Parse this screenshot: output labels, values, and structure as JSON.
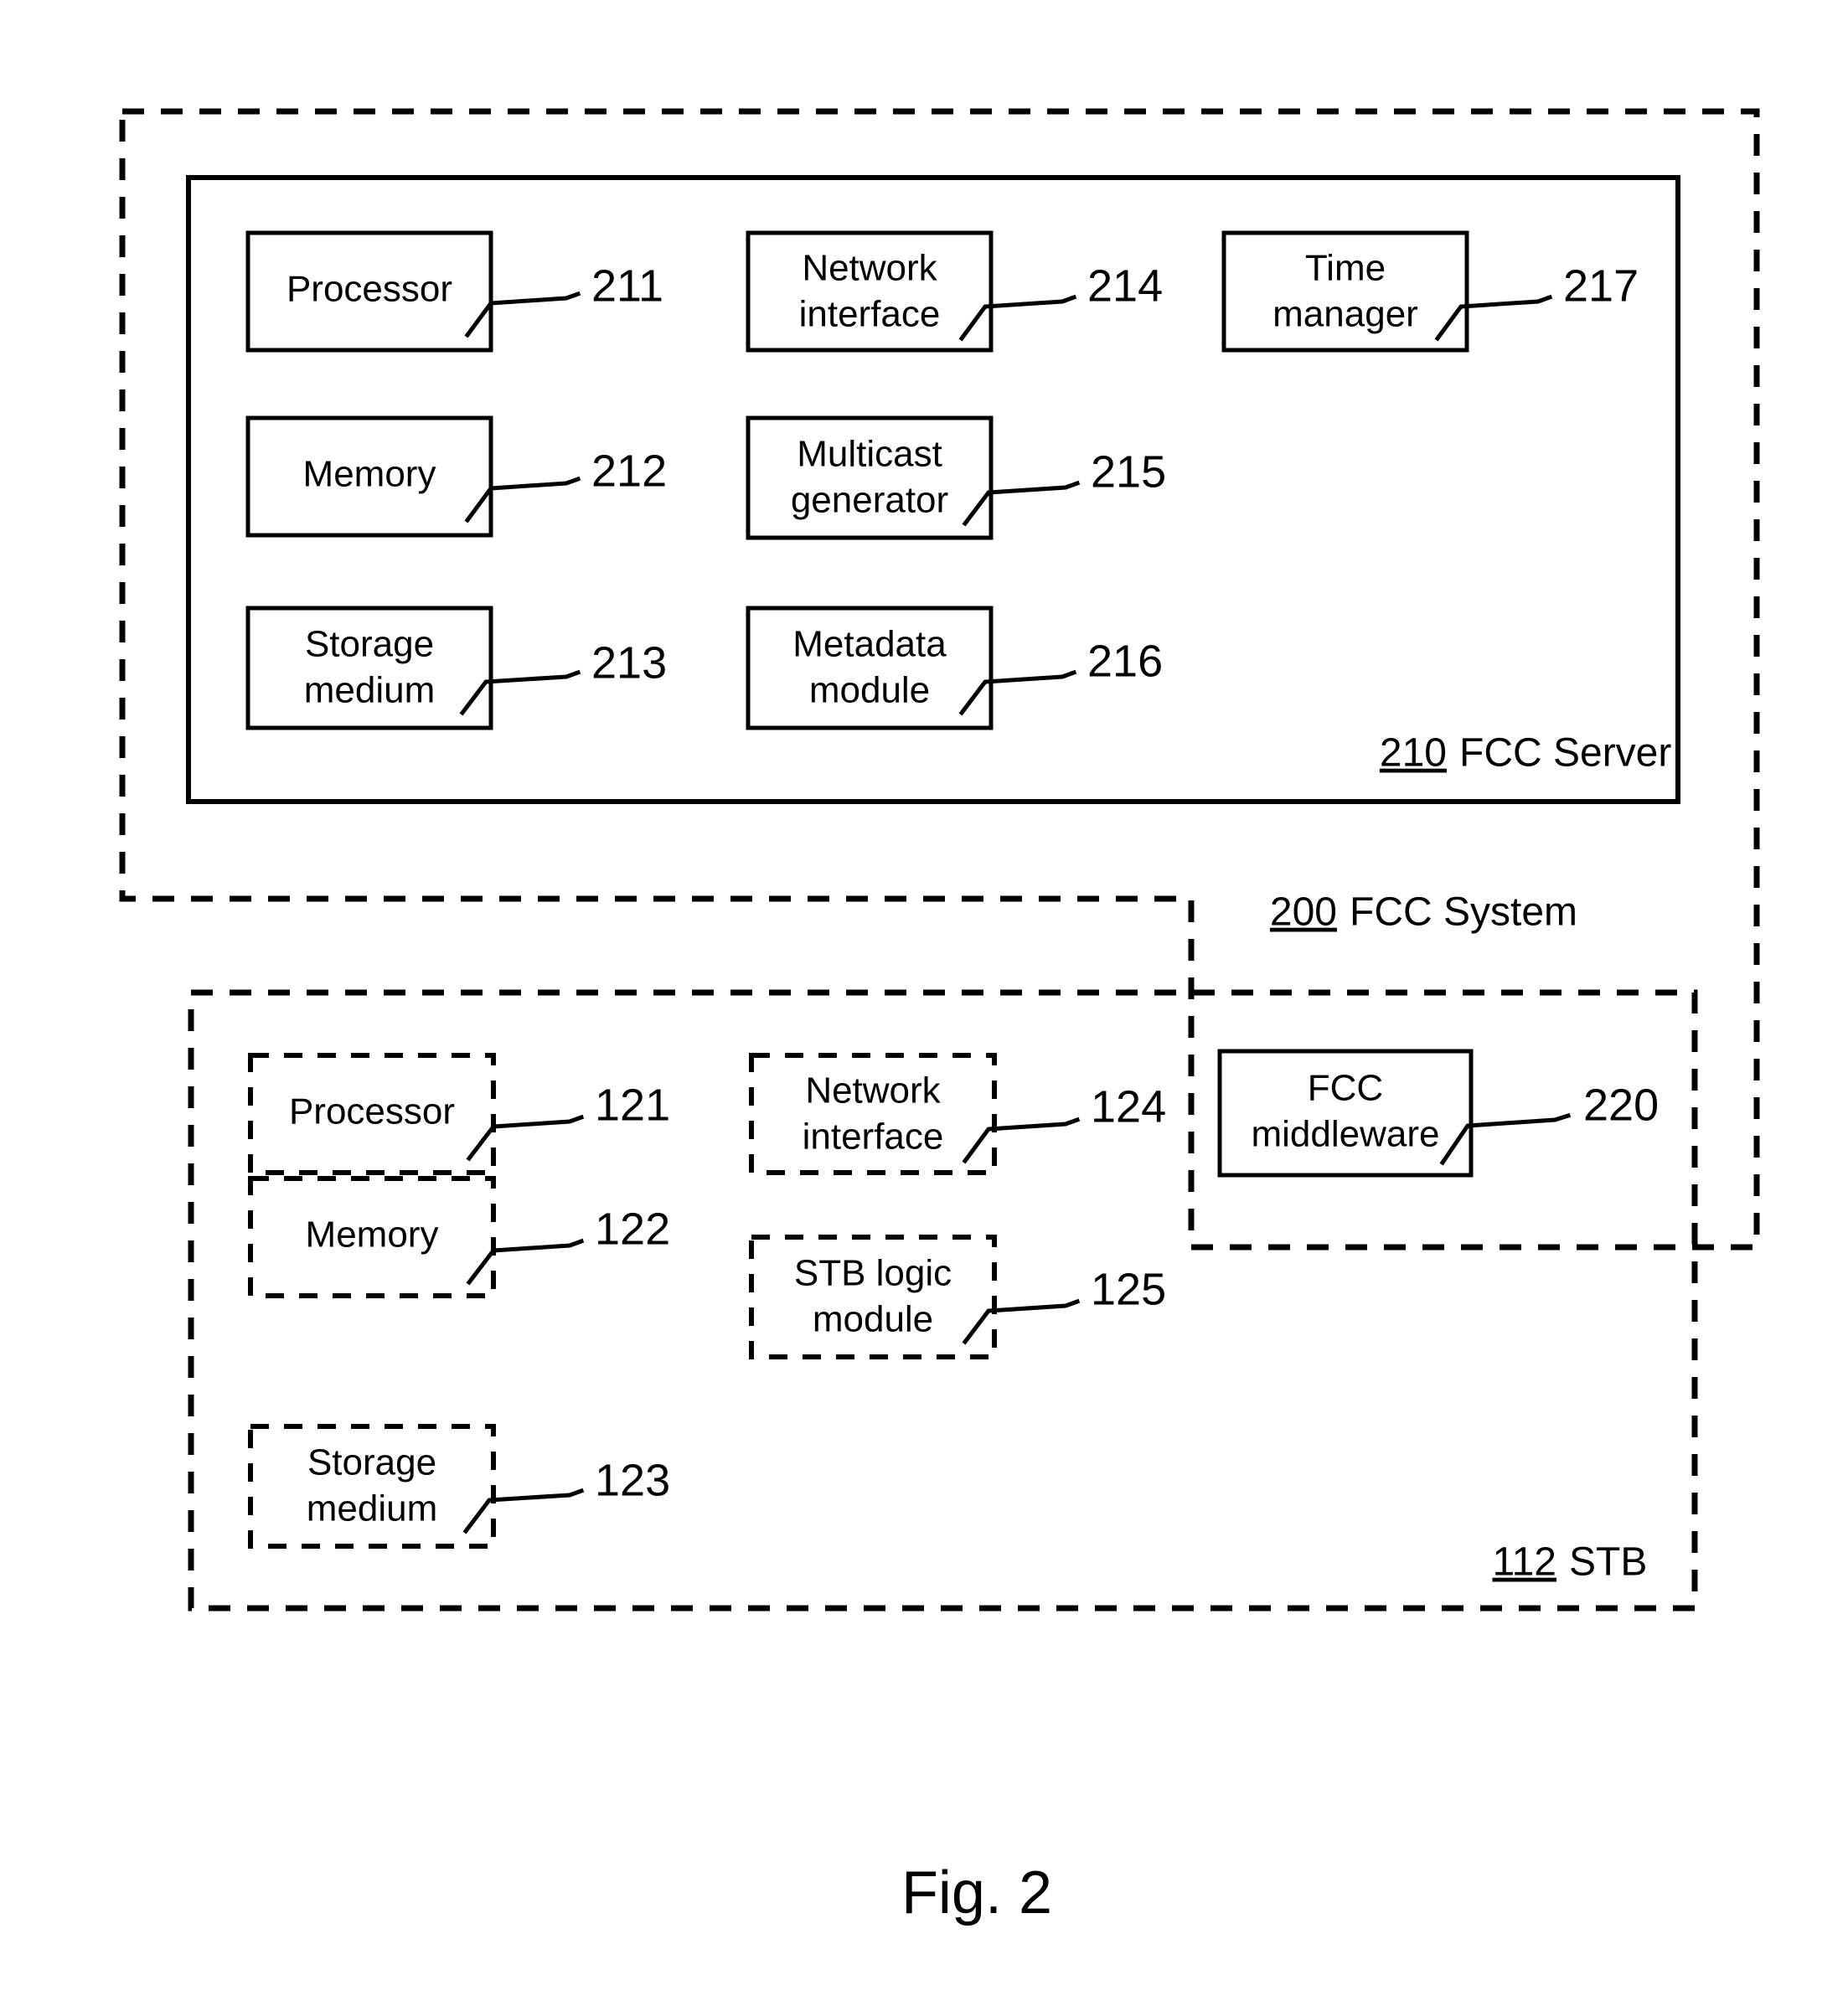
{
  "figure": {
    "caption": "Fig. 2"
  },
  "fcc_system": {
    "ref": "200",
    "label": "FCC System"
  },
  "fcc_server": {
    "ref": "210",
    "label": "FCC Server",
    "components": [
      {
        "label_line1": "Processor",
        "label_line2": "",
        "ref": "211"
      },
      {
        "label_line1": "Memory",
        "label_line2": "",
        "ref": "212"
      },
      {
        "label_line1": "Storage",
        "label_line2": "medium",
        "ref": "213"
      },
      {
        "label_line1": "Network",
        "label_line2": "interface",
        "ref": "214"
      },
      {
        "label_line1": "Multicast",
        "label_line2": "generator",
        "ref": "215"
      },
      {
        "label_line1": "Metadata",
        "label_line2": "module",
        "ref": "216"
      },
      {
        "label_line1": "Time",
        "label_line2": "manager",
        "ref": "217"
      }
    ]
  },
  "stb": {
    "ref": "112",
    "label": "STB",
    "components": [
      {
        "label_line1": "Processor",
        "label_line2": "",
        "ref": "121"
      },
      {
        "label_line1": "Memory",
        "label_line2": "",
        "ref": "122"
      },
      {
        "label_line1": "Storage",
        "label_line2": "medium",
        "ref": "123"
      },
      {
        "label_line1": "Network",
        "label_line2": "interface",
        "ref": "124"
      },
      {
        "label_line1": "STB logic",
        "label_line2": "module",
        "ref": "125"
      }
    ]
  },
  "fcc_middleware": {
    "label_line1": "FCC",
    "label_line2": "middleware",
    "ref": "220"
  },
  "colors": {
    "ink": "#000000",
    "paper": "#ffffff"
  }
}
